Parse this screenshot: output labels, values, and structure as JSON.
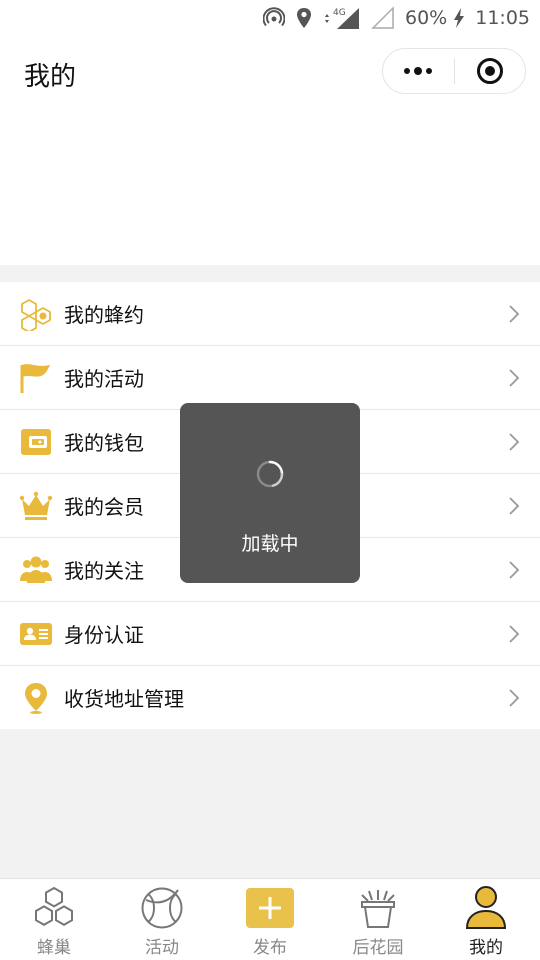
{
  "status_bar": {
    "battery": "60%",
    "time": "11:05",
    "network": "4G"
  },
  "header": {
    "title": "我的"
  },
  "menu": {
    "items": [
      {
        "label": "我的蜂约",
        "icon": "honeycomb-icon"
      },
      {
        "label": "我的活动",
        "icon": "flag-icon"
      },
      {
        "label": "我的钱包",
        "icon": "wallet-icon"
      },
      {
        "label": "我的会员",
        "icon": "crown-icon"
      },
      {
        "label": "我的关注",
        "icon": "people-icon"
      },
      {
        "label": "身份认证",
        "icon": "id-card-icon"
      },
      {
        "label": "收货地址管理",
        "icon": "location-pin-icon"
      }
    ]
  },
  "toast": {
    "message": "加载中"
  },
  "tabbar": {
    "items": [
      {
        "label": "蜂巢",
        "icon": "hive-icon",
        "active": false
      },
      {
        "label": "活动",
        "icon": "ball-icon",
        "active": false
      },
      {
        "label": "发布",
        "icon": "plus-icon",
        "active": false
      },
      {
        "label": "后花园",
        "icon": "plant-pot-icon",
        "active": false
      },
      {
        "label": "我的",
        "icon": "user-icon",
        "active": true
      }
    ]
  },
  "colors": {
    "accent": "#e8b93a",
    "text": "#111111",
    "muted": "#888888",
    "background": "#f2f2f2"
  }
}
